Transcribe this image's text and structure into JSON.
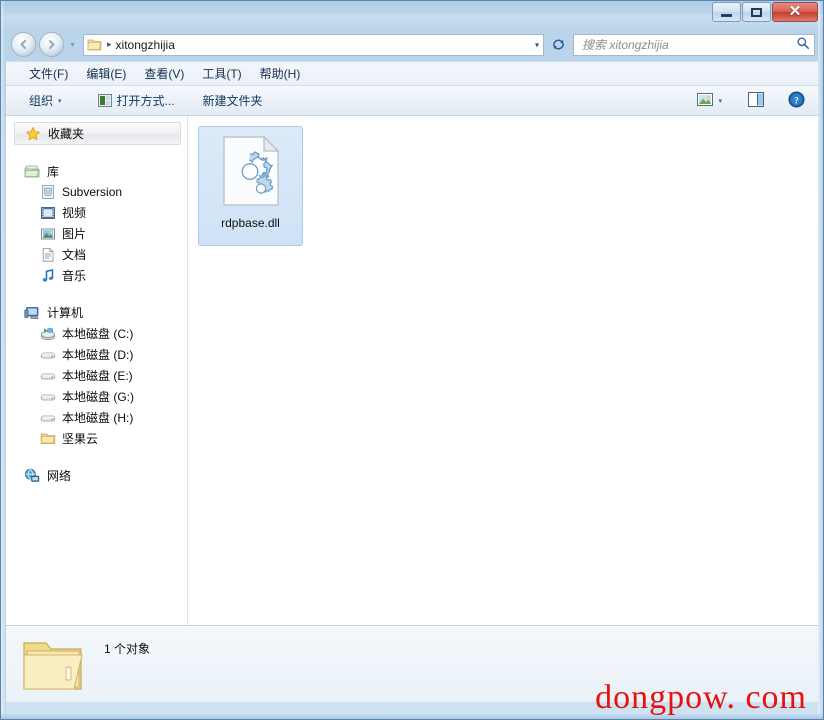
{
  "window": {
    "title": "",
    "controls": {
      "minimize": "minimize-button",
      "maximize": "maximize-button",
      "close": "✕"
    }
  },
  "address": {
    "back_label": "◀",
    "forward_label": "▶",
    "history_label": "▾",
    "folder_icon": "folder-icon",
    "separator": "▸",
    "path": "xitongzhijia",
    "dropdown": "▾",
    "refresh_icon": "refresh-icon"
  },
  "search": {
    "placeholder": "搜索 xitongzhijia",
    "icon": "search-icon"
  },
  "menu": {
    "items": [
      {
        "label": "文件(F)"
      },
      {
        "label": "编辑(E)"
      },
      {
        "label": "查看(V)"
      },
      {
        "label": "工具(T)"
      },
      {
        "label": "帮助(H)"
      }
    ]
  },
  "toolbar": {
    "organize_label": "组织",
    "organize_caret": "▾",
    "open_with_label": "打开方式...",
    "new_folder_label": "新建文件夹",
    "view_caret": "▾",
    "view_icon": "view-mode-icon",
    "preview_icon": "preview-pane-icon",
    "help_icon": "help-icon",
    "help_glyph": "?"
  },
  "sidebar": {
    "favorites": {
      "label": "收藏夹",
      "icon": "star-icon"
    },
    "groups": [
      {
        "label": "库",
        "icon": "library-icon",
        "children": [
          {
            "label": "Subversion",
            "icon": "subversion-icon"
          },
          {
            "label": "视频",
            "icon": "video-icon"
          },
          {
            "label": "图片",
            "icon": "pictures-icon"
          },
          {
            "label": "文档",
            "icon": "documents-icon"
          },
          {
            "label": "音乐",
            "icon": "music-icon"
          }
        ]
      },
      {
        "label": "计算机",
        "icon": "computer-icon",
        "children": [
          {
            "label": "本地磁盘 (C:)",
            "icon": "system-drive-icon"
          },
          {
            "label": "本地磁盘 (D:)",
            "icon": "drive-icon"
          },
          {
            "label": "本地磁盘 (E:)",
            "icon": "drive-icon"
          },
          {
            "label": "本地磁盘 (G:)",
            "icon": "drive-icon"
          },
          {
            "label": "本地磁盘 (H:)",
            "icon": "drive-icon"
          },
          {
            "label": "坚果云",
            "icon": "folder-icon"
          }
        ]
      },
      {
        "label": "网络",
        "icon": "network-icon",
        "children": []
      }
    ]
  },
  "content": {
    "files": [
      {
        "name": "rdpbase.dll",
        "icon": "dll-gear-icon",
        "selected": true
      }
    ]
  },
  "status": {
    "folder_icon": "folder-open-icon",
    "text": "1 个对象"
  },
  "watermark": {
    "text": "dongpow. com",
    "color": "#e81010"
  }
}
